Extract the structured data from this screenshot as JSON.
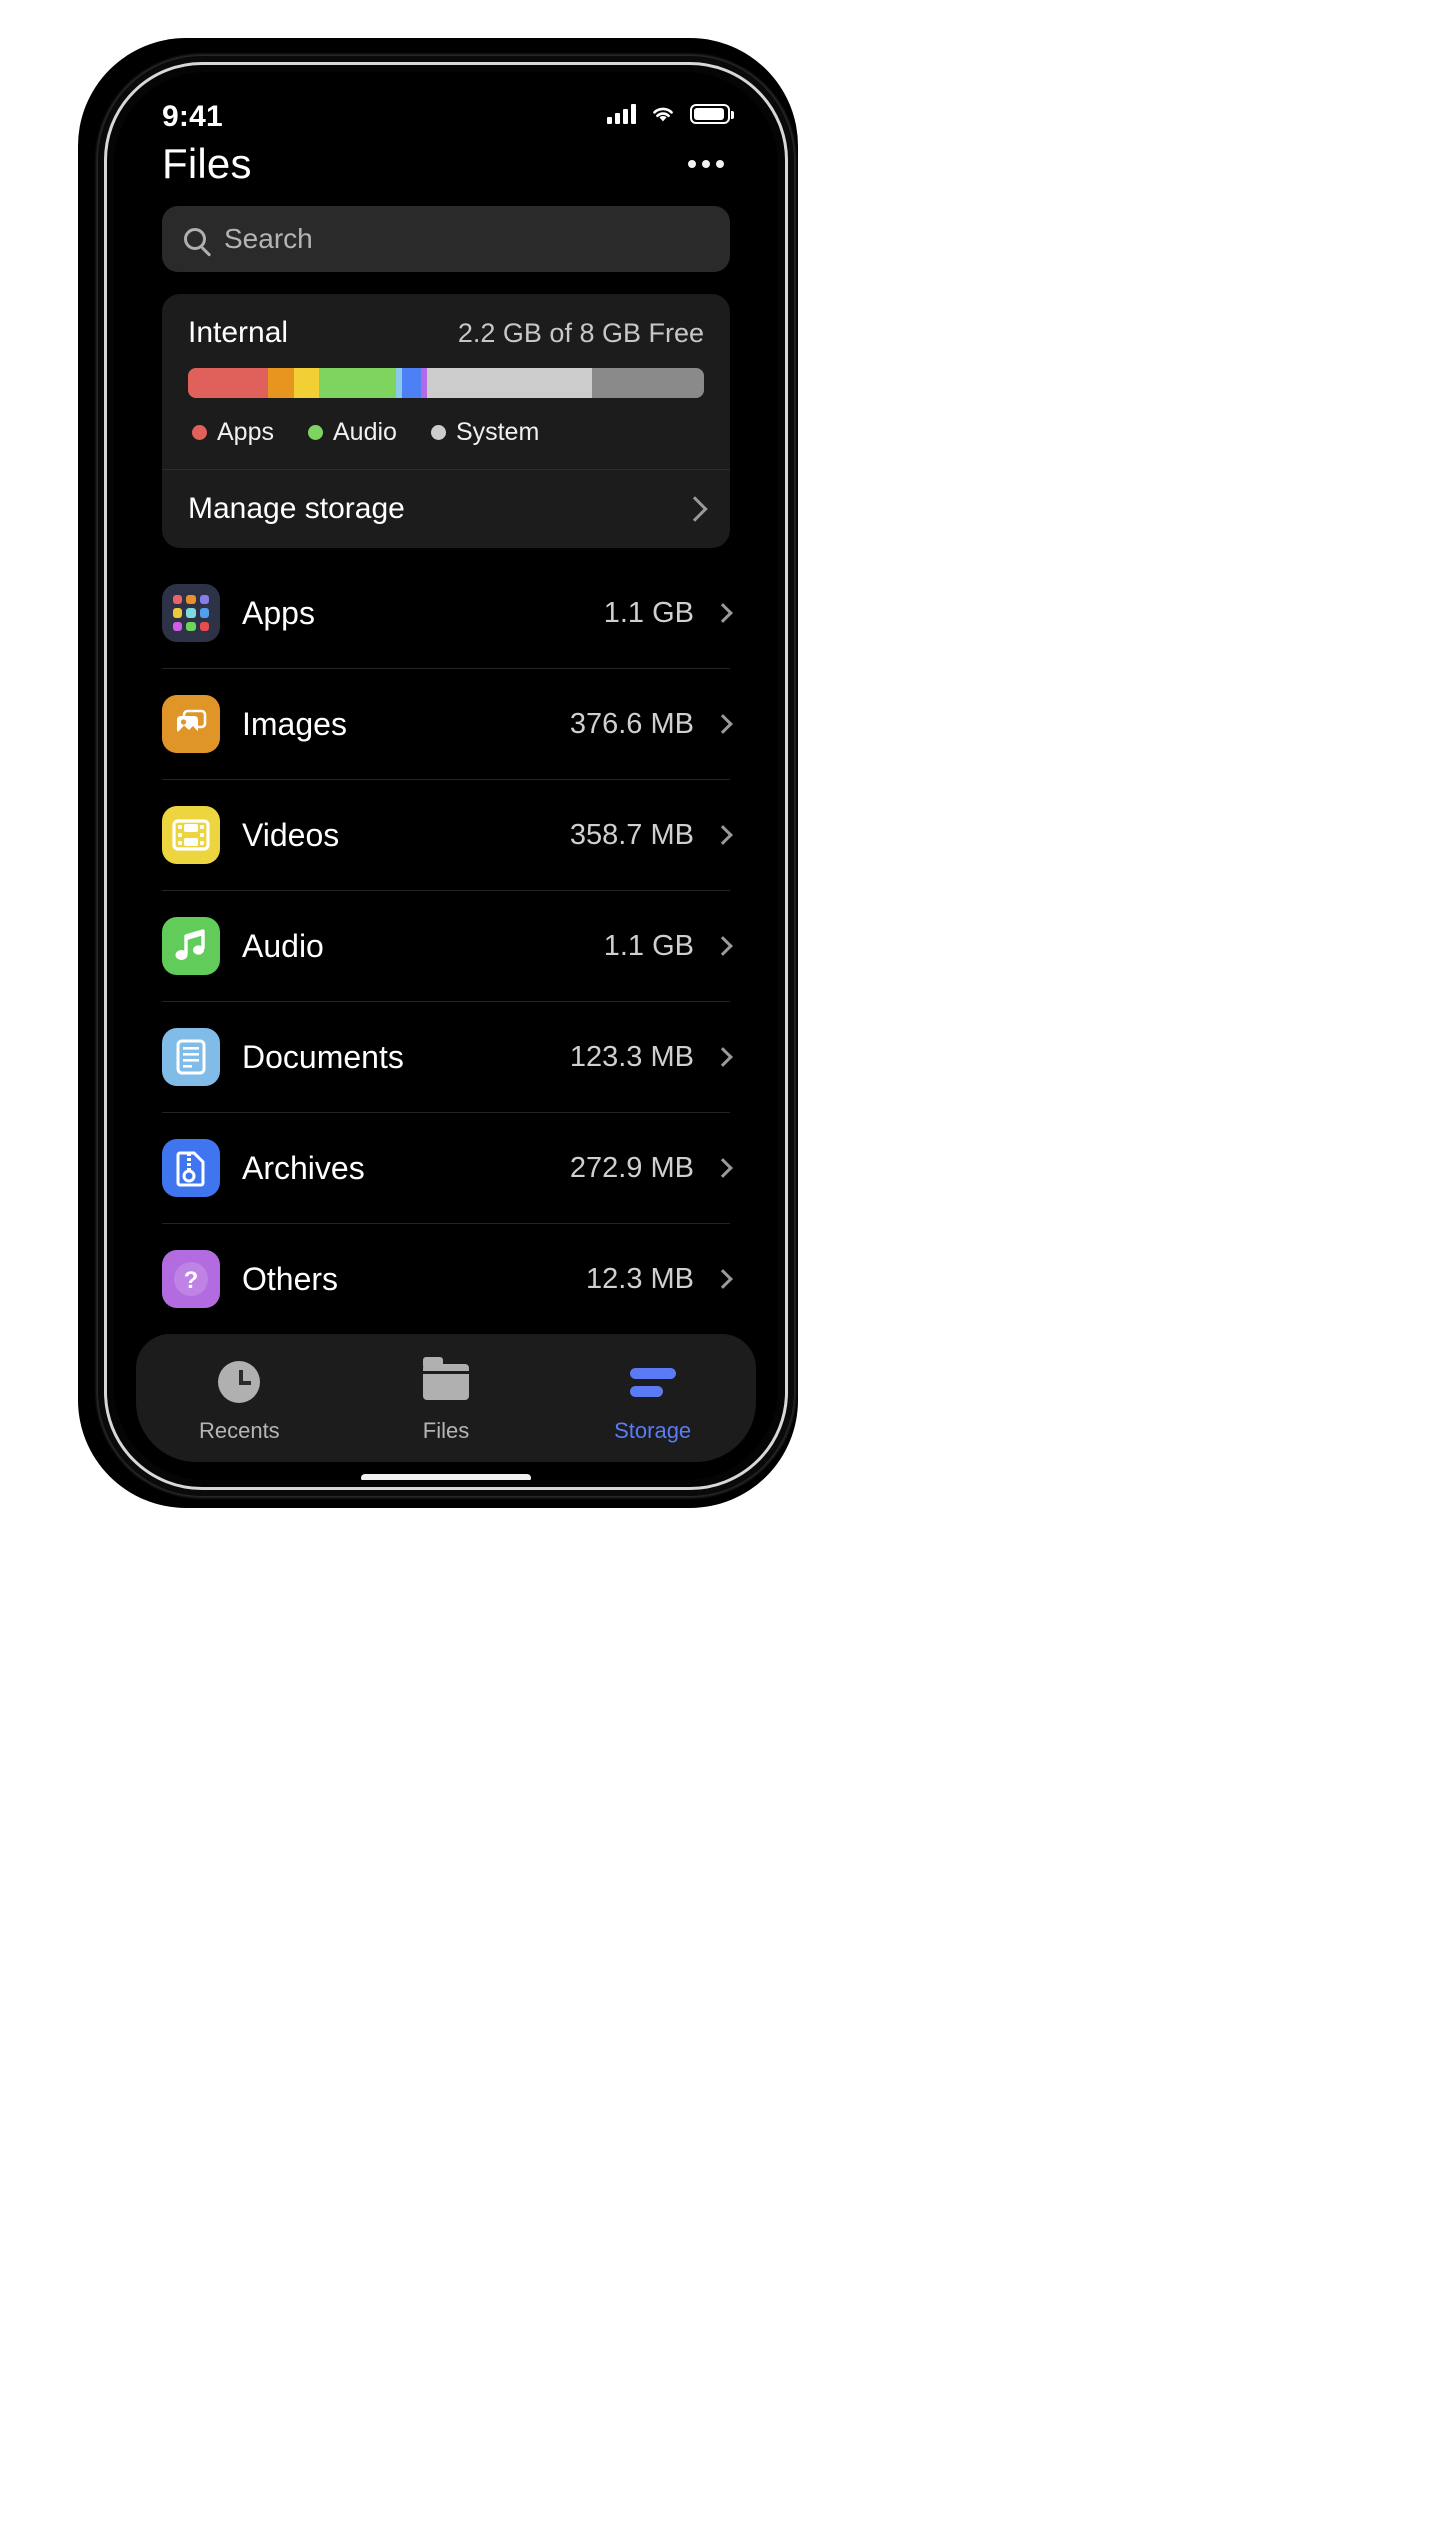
{
  "status_bar": {
    "time": "9:41",
    "icons": [
      "cellular-signal-icon",
      "wifi-icon",
      "battery-icon"
    ]
  },
  "nav": {
    "title": "Files",
    "more_menu": "more-options-icon"
  },
  "search": {
    "placeholder": "Search",
    "value": "",
    "icon": "search-icon"
  },
  "storage_card": {
    "title": "Internal",
    "free_text": "2.2 GB of 8 GB Free",
    "manage_label": "Manage storage",
    "chevron": "chevron-right-icon",
    "segments": [
      {
        "name": "Apps",
        "color": "#e0605c",
        "percent": 15.5
      },
      {
        "name": "Images",
        "color": "#e8951f",
        "percent": 5.0
      },
      {
        "name": "Videos",
        "color": "#f2d035",
        "percent": 4.8
      },
      {
        "name": "Audio",
        "color": "#7ed45e",
        "percent": 15.0
      },
      {
        "name": "Documents",
        "color": "#8cc8e8",
        "percent": 1.2
      },
      {
        "name": "Archives",
        "color": "#4d7ff5",
        "percent": 3.6
      },
      {
        "name": "Others",
        "color": "#b06ae8",
        "percent": 1.2
      },
      {
        "name": "System",
        "color": "#cccccc",
        "percent": 32.0
      },
      {
        "name": "Free",
        "color": "#8a8a8a",
        "percent": 21.7
      }
    ],
    "legend": [
      {
        "label": "Apps",
        "color": "#e0605c"
      },
      {
        "label": "Audio",
        "color": "#7ed45e"
      },
      {
        "label": "System",
        "color": "#cccccc"
      }
    ]
  },
  "categories": [
    {
      "label": "Apps",
      "size": "1.1 GB",
      "icon": "apps-grid-icon",
      "bg": "#2e3246"
    },
    {
      "label": "Images",
      "size": "376.6 MB",
      "icon": "photo-icon",
      "bg": "#e09528"
    },
    {
      "label": "Videos",
      "size": "358.7 MB",
      "icon": "film-strip-icon",
      "bg": "#ecd53f"
    },
    {
      "label": "Audio",
      "size": "1.1 GB",
      "icon": "music-note-icon",
      "bg": "#62cc5a"
    },
    {
      "label": "Documents",
      "size": "123.3 MB",
      "icon": "document-icon",
      "bg": "#81bbe8"
    },
    {
      "label": "Archives",
      "size": "272.9 MB",
      "icon": "zip-file-icon",
      "bg": "#3f76f0"
    },
    {
      "label": "Others",
      "size": "12.3 MB",
      "icon": "question-mark-icon",
      "bg": "#b26ce0"
    }
  ],
  "tabs": [
    {
      "label": "Recents",
      "icon": "clock-icon",
      "active": false
    },
    {
      "label": "Files",
      "icon": "folder-icon",
      "active": false
    },
    {
      "label": "Storage",
      "icon": "storage-bars-icon",
      "active": true
    }
  ],
  "colors": {
    "accent": "#5a7bf5",
    "screen_bg": "#000000",
    "card_bg": "#1c1c1c",
    "search_bg": "#2a2a2a"
  }
}
